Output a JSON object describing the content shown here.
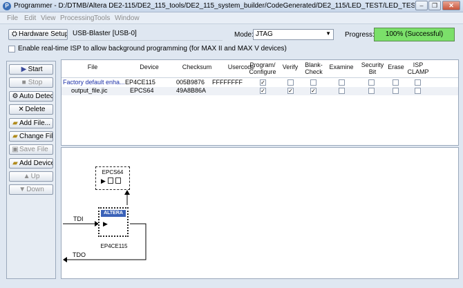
{
  "window": {
    "title": "Programmer - D:/DTMB/Altera DE2-115/DE2_115_tools/DE2_115_system_builder/CodeGenerated/DE2_115/LED_TEST/LED_TEST - LED_TEST - [LED_TEST.c..."
  },
  "menu": [
    "File",
    "Edit",
    "View",
    "Processing",
    "Tools",
    "Window"
  ],
  "toolbar": {
    "hardware_setup_label": "Hardware Setup...",
    "hardware_value": "USB-Blaster [USB-0]",
    "mode_label": "Mode:",
    "mode_value": "JTAG",
    "progress_label": "Progress:",
    "progress_text": "100% (Successful)",
    "progress_fraction": 1.0,
    "isp_label": "Enable real-time ISP to allow background programming (for MAX II and MAX V devices)"
  },
  "buttons": {
    "start": "Start",
    "stop": "Stop",
    "auto_detect": "Auto Detect",
    "delete": "Delete",
    "add_file": "Add File...",
    "change_file": "Change File...",
    "save_file": "Save File",
    "add_device": "Add Device...",
    "up": "Up",
    "down": "Down"
  },
  "table": {
    "headers": [
      "File",
      "Device",
      "Checksum",
      "Usercode",
      "Program/ Configure",
      "Verify",
      "Blank- Check",
      "Examine",
      "Security Bit",
      "Erase",
      "ISP CLAMP"
    ],
    "rows": [
      {
        "file": "Factory default enha...",
        "device": "EP4CE115",
        "checksum": "005B9876",
        "usercode": "FFFFFFFF",
        "checks": [
          true,
          false,
          false,
          false,
          false,
          false,
          false
        ]
      },
      {
        "file": "output_file.jic",
        "device": "EPCS64",
        "checksum": "49A8B86A",
        "usercode": "",
        "checks": [
          true,
          true,
          true,
          false,
          false,
          false,
          false
        ]
      }
    ]
  },
  "diagram": {
    "flash_label": "EPCS64",
    "fpga_label": "EP4CE115",
    "fpga_logo": "ALTERA",
    "tdi": "TDI",
    "tdo": "TDO"
  }
}
